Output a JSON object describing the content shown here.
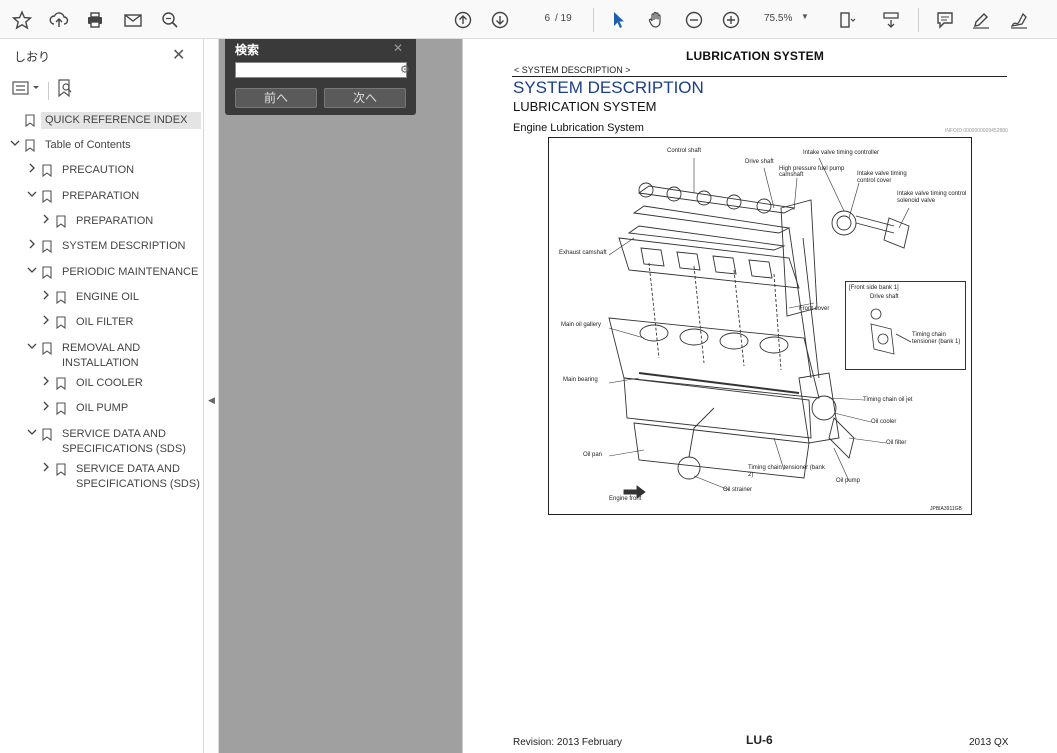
{
  "toolbar": {
    "page_current": "6",
    "page_total": "/ 19",
    "zoom": "75.5%",
    "tools_left": [
      "star-icon",
      "upload-icon",
      "print-icon",
      "mail-icon",
      "zoom-search-icon"
    ],
    "tools_right": [
      "comment-icon",
      "pen-icon",
      "sign-icon"
    ]
  },
  "left_panel": {
    "title": "しおり",
    "close": "✕",
    "bookmarks": [
      {
        "label": "QUICK REFERENCE INDEX",
        "level": 0,
        "expander": "",
        "selected": true
      },
      {
        "label": "Table of Contents",
        "level": 0,
        "expander": "v"
      },
      {
        "label": "PRECAUTION",
        "level": 1,
        "expander": ">"
      },
      {
        "label": "PREPARATION",
        "level": 1,
        "expander": "v"
      },
      {
        "label": "PREPARATION",
        "level": 2,
        "expander": ">"
      },
      {
        "label": "SYSTEM DESCRIPTION",
        "level": 1,
        "expander": ">"
      },
      {
        "label": "PERIODIC MAINTENANCE",
        "level": 1,
        "expander": "v"
      },
      {
        "label": "ENGINE OIL",
        "level": 2,
        "expander": ">"
      },
      {
        "label": "OIL FILTER",
        "level": 2,
        "expander": ">"
      },
      {
        "label": "REMOVAL AND INSTALLATION",
        "level": 1,
        "expander": "v"
      },
      {
        "label": "OIL COOLER",
        "level": 2,
        "expander": ">"
      },
      {
        "label": "OIL PUMP",
        "level": 2,
        "expander": ">"
      },
      {
        "label": "SERVICE DATA AND SPECIFICATIONS (SDS)",
        "level": 1,
        "expander": "v"
      },
      {
        "label": "SERVICE DATA AND SPECIFICATIONS (SDS)",
        "level": 2,
        "expander": ">"
      }
    ]
  },
  "search": {
    "title": "検索",
    "close": "✕",
    "prev": "前へ",
    "next": "次へ"
  },
  "document": {
    "header": "LUBRICATION SYSTEM",
    "breadcrumb": "< SYSTEM DESCRIPTION >",
    "title": "SYSTEM DESCRIPTION",
    "subtitle": "LUBRICATION SYSTEM",
    "section": "Engine Lubrication System",
    "ref_code": "INFOID:0000000009452880",
    "figure_labels": {
      "control_shaft": "Control shaft",
      "drive_shaft": "Drive shaft",
      "hp_pump": "High pressure fuel pump camshaft",
      "ivt_controller": "Intake valve timing controller",
      "ivt_cover": "Intake valve timing control cover",
      "ivt_solenoid": "Intake valve timing control solenoid valve",
      "exhaust_cam": "Exhaust camshaft",
      "front_cover": "Front cover",
      "inset_title": "[Front side bank 1]",
      "inset_drive": "Drive shaft",
      "inset_tensioner": "Timing chain tensioner (bank 1)",
      "main_gallery": "Main oil gallery",
      "main_bearing": "Main bearing",
      "chain_jet": "Timing chain oil jet",
      "oil_cooler": "Oil cooler",
      "oil_filter": "Oil filter",
      "oil_pan": "Oil pan",
      "tensioner_b2": "Timing chain tensioner (bank 2)",
      "oil_pump": "Oil pump",
      "engine_front": "Engine front",
      "oil_strainer": "Oil strainer",
      "fig_code": "JPBIA3911GB"
    },
    "footer_left": "Revision: 2013 February",
    "footer_center": "LU-6",
    "footer_right": "2013 QX"
  }
}
